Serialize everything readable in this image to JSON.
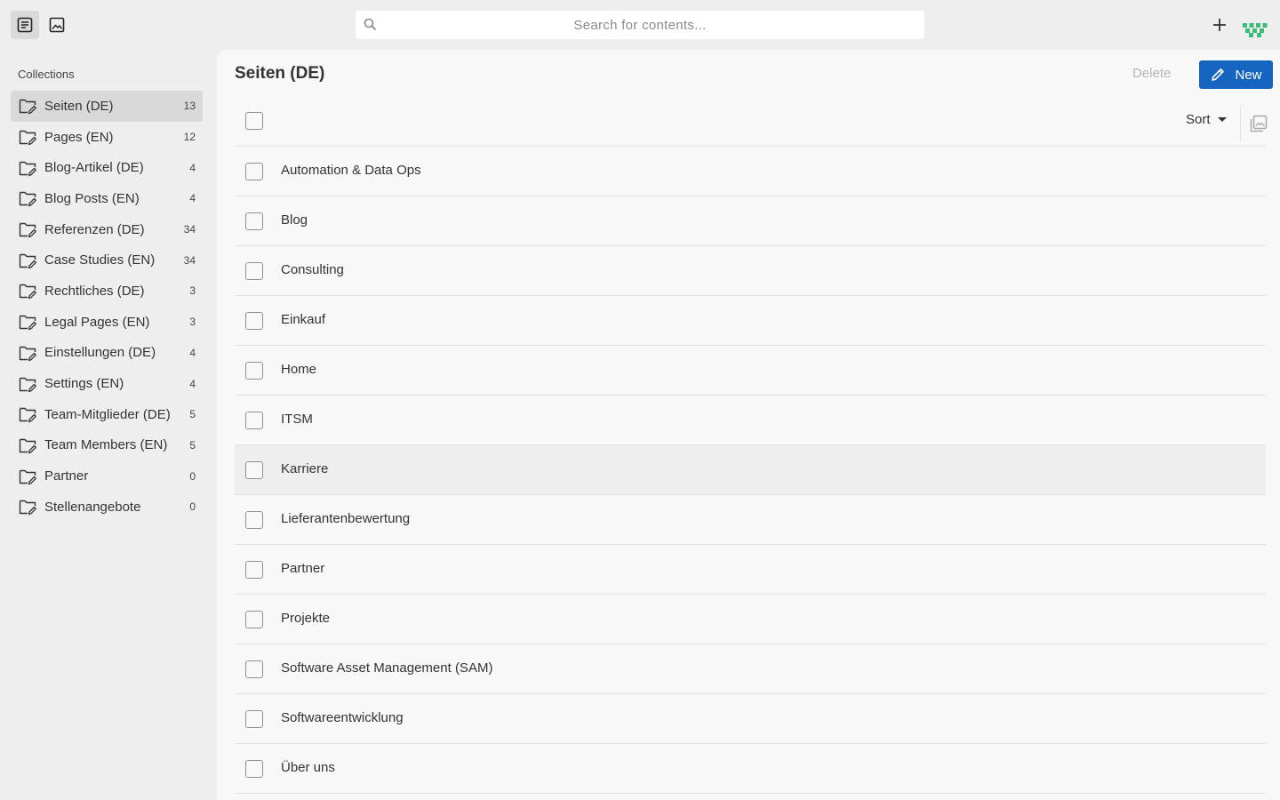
{
  "search": {
    "placeholder": "Search for contents..."
  },
  "sidebar": {
    "title": "Collections",
    "items": [
      {
        "label": "Seiten (DE)",
        "count": "13",
        "active": true
      },
      {
        "label": "Pages (EN)",
        "count": "12"
      },
      {
        "label": "Blog-Artikel (DE)",
        "count": "4"
      },
      {
        "label": "Blog Posts (EN)",
        "count": "4"
      },
      {
        "label": "Referenzen (DE)",
        "count": "34"
      },
      {
        "label": "Case Studies (EN)",
        "count": "34"
      },
      {
        "label": "Rechtliches (DE)",
        "count": "3"
      },
      {
        "label": "Legal Pages (EN)",
        "count": "3"
      },
      {
        "label": "Einstellungen (DE)",
        "count": "4"
      },
      {
        "label": "Settings (EN)",
        "count": "4"
      },
      {
        "label": "Team-Mitglieder (DE)",
        "count": "5"
      },
      {
        "label": "Team Members (EN)",
        "count": "5"
      },
      {
        "label": "Partner",
        "count": "0"
      },
      {
        "label": "Stellenangebote",
        "count": "0"
      }
    ]
  },
  "main": {
    "title": "Seiten (DE)",
    "delete_label": "Delete",
    "new_label": "New",
    "sort_label": "Sort",
    "entries": [
      "Automation & Data Ops",
      "Blog",
      "Consulting",
      "Einkauf",
      "Home",
      "ITSM",
      "Karriere",
      "Lieferantenbewertung",
      "Partner",
      "Projekte",
      "Software Asset Management (SAM)",
      "Softwareentwicklung",
      "Über uns"
    ]
  },
  "colors": {
    "accent": "#1565c0",
    "logo": "#3dbb7a",
    "background": "#eeeeee",
    "panel": "#f8f8f8"
  }
}
